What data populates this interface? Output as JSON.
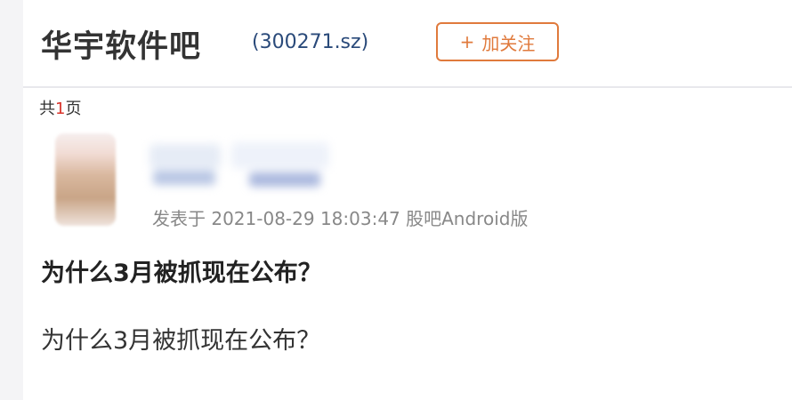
{
  "header": {
    "bar_name": "华宇软件吧",
    "stock_code": "(300271.sz)",
    "follow_button": {
      "icon": "plus-icon",
      "plus": "+",
      "label": "加关注"
    },
    "accent_color": "#e07a3c"
  },
  "pagination": {
    "prefix": "共",
    "total_pages": "1",
    "suffix": "页"
  },
  "post": {
    "author": {
      "avatar": "avatar",
      "name_blurred": true
    },
    "meta": "发表于 2021-08-29 18:03:47 股吧Android版",
    "title": "为什么3月被抓现在公布？",
    "body": "为什么3月被抓现在公布？"
  }
}
